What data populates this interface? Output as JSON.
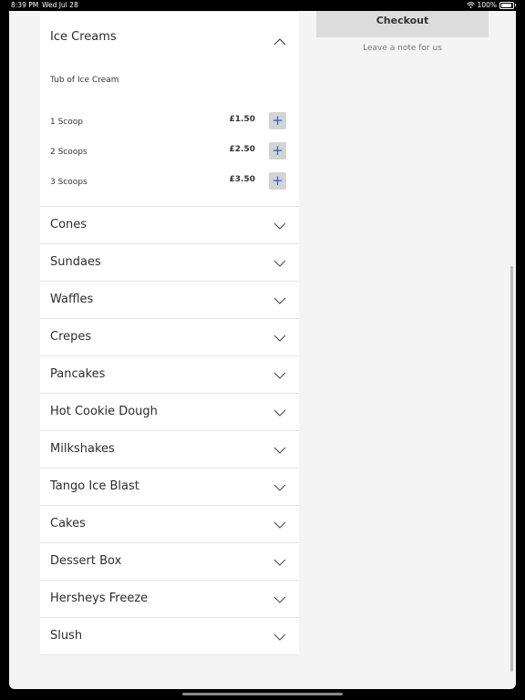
{
  "status_bar": {
    "time": "8:39 PM",
    "date": "Wed Jul 28",
    "battery": "100%"
  },
  "expanded_category": {
    "title": "Ice Creams",
    "subtitle": "Tub of Ice Cream",
    "items": [
      {
        "label": "1 Scoop",
        "price": "£1.50"
      },
      {
        "label": "2 Scoops",
        "price": "£2.50"
      },
      {
        "label": "3 Scoops",
        "price": "£3.50"
      }
    ]
  },
  "categories": [
    "Cones",
    "Sundaes",
    "Waffles",
    "Crepes",
    "Pancakes",
    "Hot Cookie Dough",
    "Milkshakes",
    "Tango Ice Blast",
    "Cakes",
    "Dessert Box",
    "Hersheys Freeze",
    "Slush"
  ],
  "sidebar": {
    "checkout_label": "Checkout",
    "note_link": "Leave a note for us"
  },
  "plus_symbol": "+",
  "colors": {
    "accent": "#2563c9",
    "background": "#f4f4f4"
  }
}
